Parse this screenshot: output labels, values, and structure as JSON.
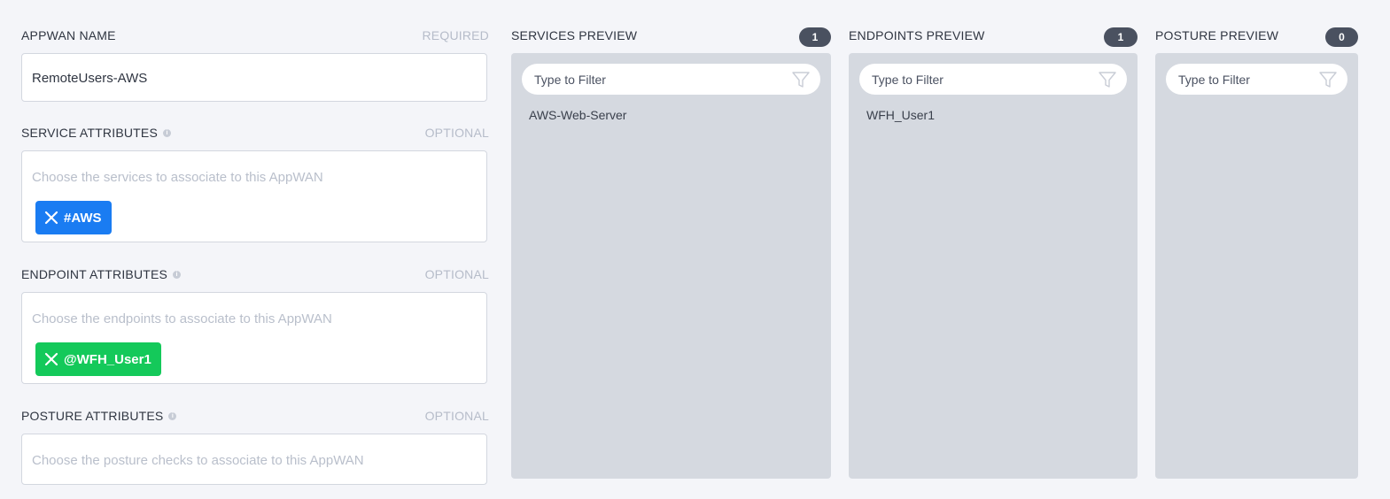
{
  "form": {
    "appwan_name": {
      "label": "APPWAN NAME",
      "tag": "REQUIRED",
      "value": "RemoteUsers-AWS"
    },
    "service_attributes": {
      "label": "SERVICE ATTRIBUTES",
      "tag": "OPTIONAL",
      "placeholder": "Choose the services to associate to this AppWAN",
      "chips": [
        "#AWS"
      ]
    },
    "endpoint_attributes": {
      "label": "ENDPOINT ATTRIBUTES",
      "tag": "OPTIONAL",
      "placeholder": "Choose the endpoints to associate to this AppWAN",
      "chips": [
        "@WFH_User1"
      ]
    },
    "posture_attributes": {
      "label": "POSTURE ATTRIBUTES",
      "tag": "OPTIONAL",
      "placeholder": "Choose the posture checks to associate to this AppWAN"
    }
  },
  "panels": {
    "services": {
      "title": "SERVICES PREVIEW",
      "count": "1",
      "filter_placeholder": "Type to Filter",
      "items": [
        "AWS-Web-Server"
      ]
    },
    "endpoints": {
      "title": "ENDPOINTS PREVIEW",
      "count": "1",
      "filter_placeholder": "Type to Filter",
      "items": [
        "WFH_User1"
      ]
    },
    "posture": {
      "title": "POSTURE PREVIEW",
      "count": "0",
      "filter_placeholder": "Type to Filter",
      "items": []
    }
  },
  "colors": {
    "service_chip": "#1a7cf2",
    "endpoint_chip": "#14c95a",
    "panel_bg": "#d5d9e0",
    "badge_bg": "#4a5160"
  },
  "icons": {
    "chip_remove": "close-icon",
    "filter": "funnel-icon",
    "info": "info-icon"
  }
}
